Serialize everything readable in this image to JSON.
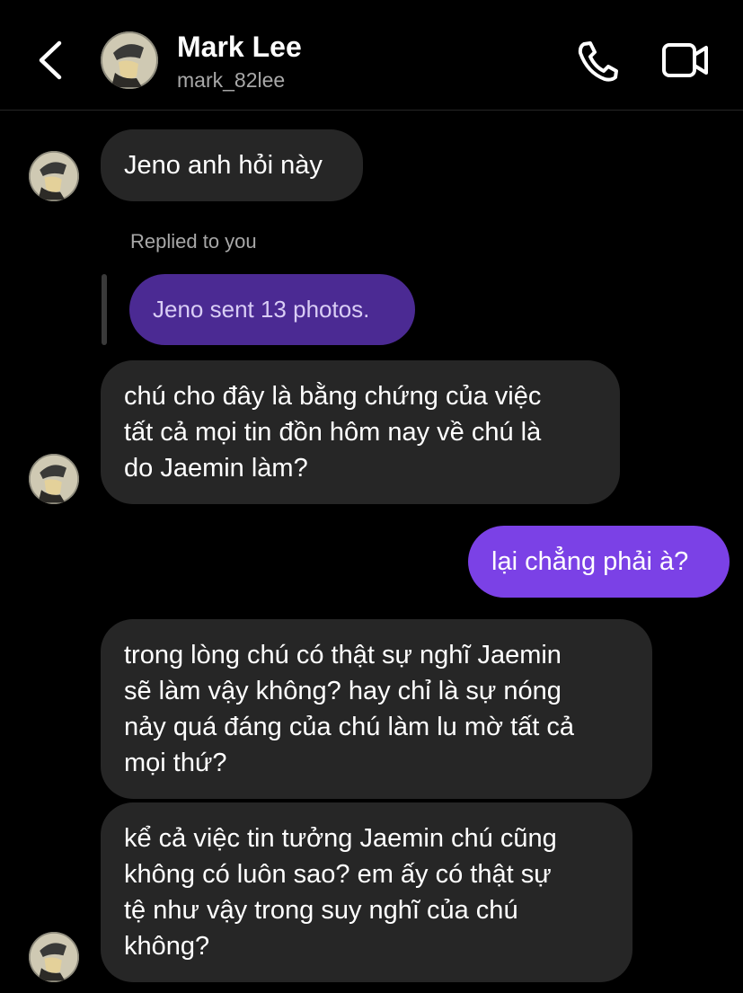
{
  "header": {
    "name": "Mark Lee",
    "username": "mark_82lee"
  },
  "colors": {
    "background": "#000000",
    "incoming_bubble": "#262626",
    "outgoing_bubble": "#7b41e6",
    "quoted_bubble": "#4b2a93",
    "secondary_text": "#a8a8a8"
  },
  "icons": [
    "back-icon",
    "phone-icon",
    "video-call-icon"
  ],
  "messages": {
    "m1": "Jeno anh hỏi này",
    "reply_label": "Replied to you",
    "reply_quote": "Jeno sent 13 photos.",
    "m2": "chú cho đây là bằng chứng của việc\ntất cả mọi tin đồn hôm nay về chú là\ndo Jaemin làm?",
    "m3": "lại chẳng phải à?",
    "m4": "trong lòng chú có thật sự nghĩ Jaemin\nsẽ làm vậy không? hay chỉ là sự nóng\nnảy quá đáng của chú làm lu mờ tất cả\nmọi thứ?",
    "m5": "kể cả việc tin tưởng Jaemin chú cũng\nkhông có luôn sao? em ấy có thật sự\ntệ như vậy trong suy nghĩ của chú\nkhông?"
  }
}
